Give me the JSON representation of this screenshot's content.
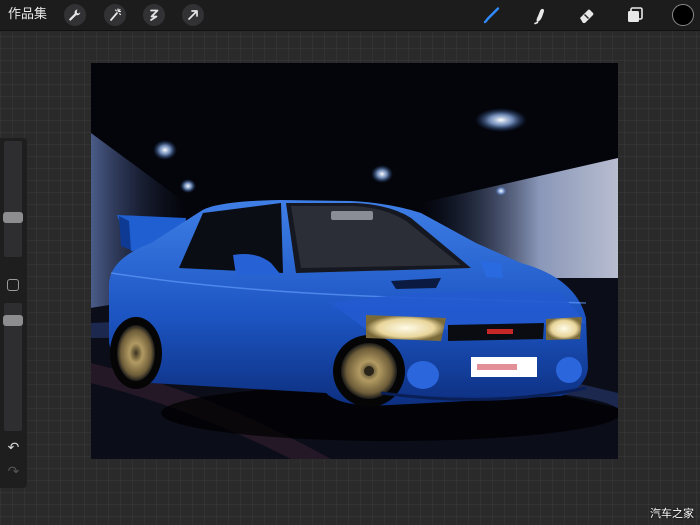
{
  "header": {
    "gallery_label": "作品集"
  },
  "toolbar": {
    "left_tools": [
      "wrench-icon",
      "magic-wand-icon",
      "selection-icon",
      "transform-arrow-icon"
    ],
    "right_tools": [
      "brush-icon",
      "smudge-icon",
      "eraser-icon",
      "layers-icon"
    ],
    "active_tool": "brush-icon",
    "accent_color": "#2f8bff",
    "current_color": "#000000"
  },
  "sidebar": {
    "brush_size": 0.55,
    "opacity": 0.9
  },
  "canvas": {
    "image": "blue-sports-car-tunnel"
  },
  "watermark": {
    "text": "汽车之家"
  }
}
